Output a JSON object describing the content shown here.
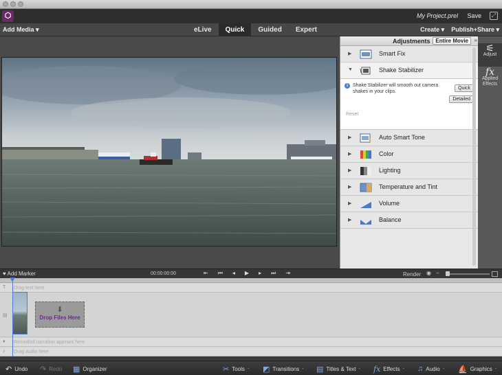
{
  "app": {
    "logo_glyph": "⬡",
    "project_name": "My Project.prel",
    "save_label": "Save",
    "fullscreen_glyph": "⤢"
  },
  "menubar": {
    "add_media": "Add Media ▾",
    "modes": [
      {
        "label": "eLive",
        "active": false
      },
      {
        "label": "Quick",
        "active": true
      },
      {
        "label": "Guided",
        "active": false
      },
      {
        "label": "Expert",
        "active": false
      }
    ],
    "create": "Create ▾",
    "publish": "Publish+Share ▾"
  },
  "adjustments": {
    "title": "Adjustments",
    "scope": "Entire Movie",
    "collapse": "»",
    "items": [
      {
        "label": "Smart Fix",
        "icon": "smart-fix-icon",
        "expanded": false
      },
      {
        "label": "Shake Stabilizer",
        "icon": "shake-stabilizer-icon",
        "expanded": true
      },
      {
        "label": "Auto Smart Tone",
        "icon": "auto-smart-tone-icon",
        "expanded": false
      },
      {
        "label": "Color",
        "icon": "color-icon",
        "expanded": false
      },
      {
        "label": "Lighting",
        "icon": "lighting-icon",
        "expanded": false
      },
      {
        "label": "Temperature and Tint",
        "icon": "temperature-icon",
        "expanded": false
      },
      {
        "label": "Volume",
        "icon": "volume-icon",
        "expanded": false
      },
      {
        "label": "Balance",
        "icon": "balance-icon",
        "expanded": false
      }
    ],
    "stabilizer": {
      "description": "Shake Stabilizer will smooth out camera shakes in your clips.",
      "quick": "Quick",
      "detailed": "Detailed",
      "reset": "Reset"
    }
  },
  "toolstrip": {
    "adjust": "Adjust",
    "applied_effects": "Applied Effects",
    "fx_glyph": "fx",
    "adjust_glyph": "⚟"
  },
  "timeline": {
    "add_marker": "Add Marker",
    "timecode": "00:00:00:00",
    "render": "Render",
    "transport": [
      "⇤",
      "⏮",
      "◂",
      "▶",
      "▸",
      "⏭",
      "⇥"
    ],
    "title_track": "Drag text here",
    "narration_track": "Recorded narration appears here",
    "audio_track": "Drag audio here",
    "drop_files": "Drop Files Here"
  },
  "bottombar": {
    "undo": "Undo",
    "redo": "Redo",
    "organizer": "Organizer",
    "tools": "Tools",
    "transitions": "Transitions",
    "titles": "Titles & Text",
    "effects": "Effects",
    "audio": "Audio",
    "graphics": "Graphics"
  },
  "colors": {
    "accent": "#4b7bd8",
    "drop_text": "#6a2a8a",
    "logo": "#6a2a6a"
  }
}
